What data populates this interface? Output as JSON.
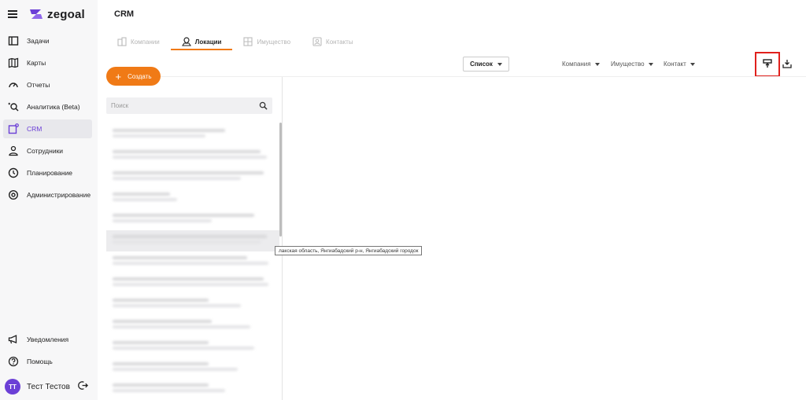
{
  "brand": {
    "name": "zegoal"
  },
  "sidebar": {
    "items": [
      {
        "label": "Задачи",
        "icon": "tasks-icon",
        "active": false
      },
      {
        "label": "Карты",
        "icon": "map-icon",
        "active": false
      },
      {
        "label": "Отчеты",
        "icon": "gauge-icon",
        "active": false
      },
      {
        "label": "Аналитика (Beta)",
        "icon": "analytics-icon",
        "active": false
      },
      {
        "label": "CRM",
        "icon": "crm-icon",
        "active": true
      },
      {
        "label": "Сотрудники",
        "icon": "employees-icon",
        "active": false
      },
      {
        "label": "Планирование",
        "icon": "clock-icon",
        "active": false
      },
      {
        "label": "Администрирование",
        "icon": "settings-icon",
        "active": false
      }
    ],
    "bottom_items": [
      {
        "label": "Уведомления",
        "icon": "megaphone-icon"
      },
      {
        "label": "Помощь",
        "icon": "help-icon"
      }
    ],
    "user": {
      "initials": "TT",
      "name": "Тест Тестов"
    }
  },
  "header": {
    "title": "CRM"
  },
  "tabs": [
    {
      "label": "Компании",
      "icon": "building-icon",
      "active": false
    },
    {
      "label": "Локации",
      "icon": "location-icon",
      "active": true
    },
    {
      "label": "Имущество",
      "icon": "asset-icon",
      "active": false
    },
    {
      "label": "Контакты",
      "icon": "contact-icon",
      "active": false
    }
  ],
  "toolbar": {
    "view_select": "Список",
    "filters": [
      "Компания",
      "Имущество",
      "Контакт"
    ],
    "upload_icon": "upload-icon",
    "download_icon": "download-icon"
  },
  "create_label": "Создать",
  "search": {
    "placeholder": "Поиск"
  },
  "tooltip": "лакская область, Янгиабадский р-н, Янгиабадский городок",
  "colors": {
    "accent": "#f07a16",
    "brand": "#6b3fd6",
    "highlight": "#e0201c"
  }
}
